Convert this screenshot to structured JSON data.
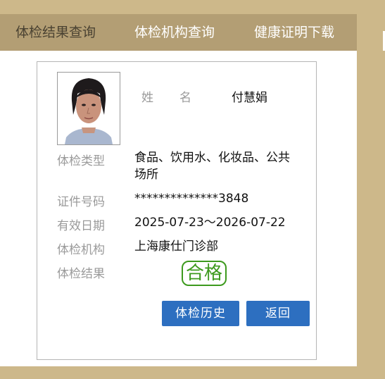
{
  "nav": {
    "items": [
      {
        "label": "体检结果查询",
        "active": true
      },
      {
        "label": "体检机构查询",
        "active": false
      },
      {
        "label": "健康证明下载",
        "active": false
      }
    ]
  },
  "person": {
    "name_label": "姓  名",
    "name_label_a": "姓",
    "name_label_b": "名",
    "name": "付慧娟"
  },
  "fields": {
    "type_label": "体检类型",
    "type_value": "食品、饮用水、化妆品、公共场所",
    "id_label": "证件号码",
    "id_value": "**************3848",
    "valid_label": "有效日期",
    "valid_value": "2025-07-23～2026-07-22",
    "org_label": "体检机构",
    "org_value": "上海康仕门诊部",
    "result_label": "体检结果",
    "result_value": "合格"
  },
  "buttons": {
    "history": "体检历史",
    "back": "返回"
  },
  "colors": {
    "page_bg": "#cdb88a",
    "nav_bg": "#b39e74",
    "button_blue": "#2d6fc0",
    "pass_green": "#3d9a1e"
  }
}
